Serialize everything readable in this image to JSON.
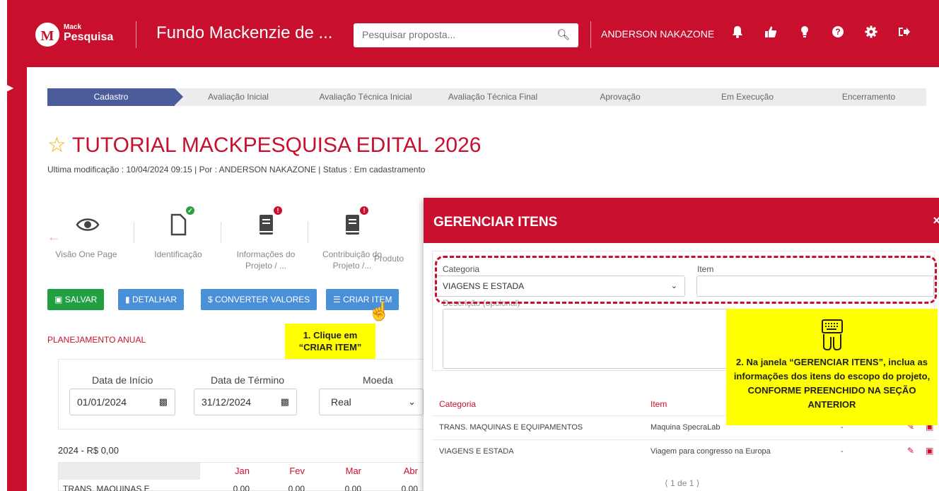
{
  "header": {
    "brand_small": "Mack",
    "brand_big": "Pesquisa",
    "logo_letter": "M",
    "app_title": "Fundo Mackenzie de ...",
    "search_placeholder": "Pesquisar proposta...",
    "user_name": "ANDERSON NAKAZONE",
    "icons": [
      "bell-icon",
      "thumbs-up-icon",
      "lightbulb-icon",
      "help-icon",
      "gear-icon",
      "logout-icon"
    ],
    "accent_color": "#c8102e"
  },
  "steps": [
    "Cadastro",
    "Avaliação Inicial",
    "Avaliação Técnica Inicial",
    "Avaliação Técnica Final",
    "Aprovação",
    "Em Execução",
    "Encerramento"
  ],
  "project": {
    "title": "TUTORIAL MACKPESQUISA EDITAL 2026",
    "subtitle": "Ultima modificação : 10/04/2024 09:15 | Por : ANDERSON NAKAZONE | Status : Em cadastramento"
  },
  "sections": [
    {
      "label": "Visão One Page",
      "icon": "eye-icon"
    },
    {
      "label": "Identificação",
      "icon": "document-icon",
      "badge": "check"
    },
    {
      "label": "Informações do Projeto / ...",
      "icon": "book-icon",
      "badge": "error"
    },
    {
      "label": "Contribuição do Projeto /...",
      "icon": "book-icon",
      "badge": "error"
    },
    {
      "label": "Produto",
      "icon": "book-icon"
    }
  ],
  "buttons": {
    "save": "SALVAR",
    "detail": "DETALHAR",
    "convert": "CONVERTER VALORES",
    "create_item": "CRIAR ITEM"
  },
  "callout1": {
    "line1": "1. Clique em",
    "line2": "“CRIAR ITEM”"
  },
  "planning": {
    "title": "PLANEJAMENTO ANUAL",
    "start_label": "Data de Início",
    "start_value": "01/01/2024",
    "end_label": "Data de Término",
    "end_value": "31/12/2024",
    "currency_label": "Moeda",
    "currency_value": "Real",
    "year_summary": "2024 - R$ 0,00",
    "months": [
      "Jan",
      "Fev",
      "Mar",
      "Abr"
    ],
    "row_label": "TRANS. MAQUINAS E",
    "row_values": [
      "0,00",
      "0,00",
      "0,00",
      "0,00"
    ]
  },
  "modal": {
    "title": "GERENCIAR ITENS",
    "close": "×",
    "category_label": "Categoria",
    "category_value": "VIAGENS E ESTADA",
    "item_label": "Item",
    "description_label": "Descrição (opcional)",
    "table_headers": {
      "category": "Categoria",
      "item": "Item"
    },
    "rows": [
      {
        "category": "TRANS. MAQUINAS E EQUIPAMENTOS",
        "item": "Maquina SpecraLab",
        "extra": "-"
      },
      {
        "category": "VIAGENS E ESTADA",
        "item": "Viagem para congresso na Europa",
        "extra": "-"
      }
    ],
    "pager": "1 de 1"
  },
  "callout2": {
    "text": "2. Na janela “GERENCIAR ITENS”, inclua as informações dos itens do escopo do projeto, CONFORME PREENCHIDO NA SEÇÃO ANTERIOR"
  }
}
